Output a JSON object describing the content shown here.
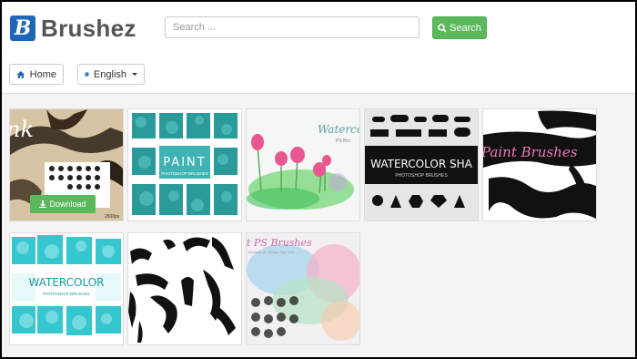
{
  "brand": {
    "logo_letter": "B",
    "name": "Brushez",
    "colors": {
      "logo": "#1f66b8",
      "text": "#555555",
      "accent_green": "#5cb85c"
    }
  },
  "search": {
    "placeholder": "Search ...",
    "button_label": "Search",
    "button_icon": "search-icon"
  },
  "nav": {
    "home_label": "Home",
    "home_icon": "home-icon",
    "language_label": "English",
    "language_icon": "globe-icon"
  },
  "gallery": {
    "items": [
      {
        "caption": "nk",
        "subcaption": "2500px",
        "download_label": "Download"
      },
      {
        "caption": "PAINT",
        "subcaption": "PHOTOSHOP BRUSHES"
      },
      {
        "caption": "Watercolor",
        "subcaption": "PS Bru"
      },
      {
        "caption": "WATERCOLOR SHA",
        "subcaption": "PHOTOSHOP BRUSHES"
      },
      {
        "caption": "Paint Brushes"
      },
      {
        "caption": "WATERCOLOR",
        "subcaption": "PHOTOSHOP BRUSHES"
      },
      {
        "caption": ""
      },
      {
        "caption": "t PS Brushes",
        "subcaption": "Brushes at 2500px High Res"
      }
    ]
  }
}
